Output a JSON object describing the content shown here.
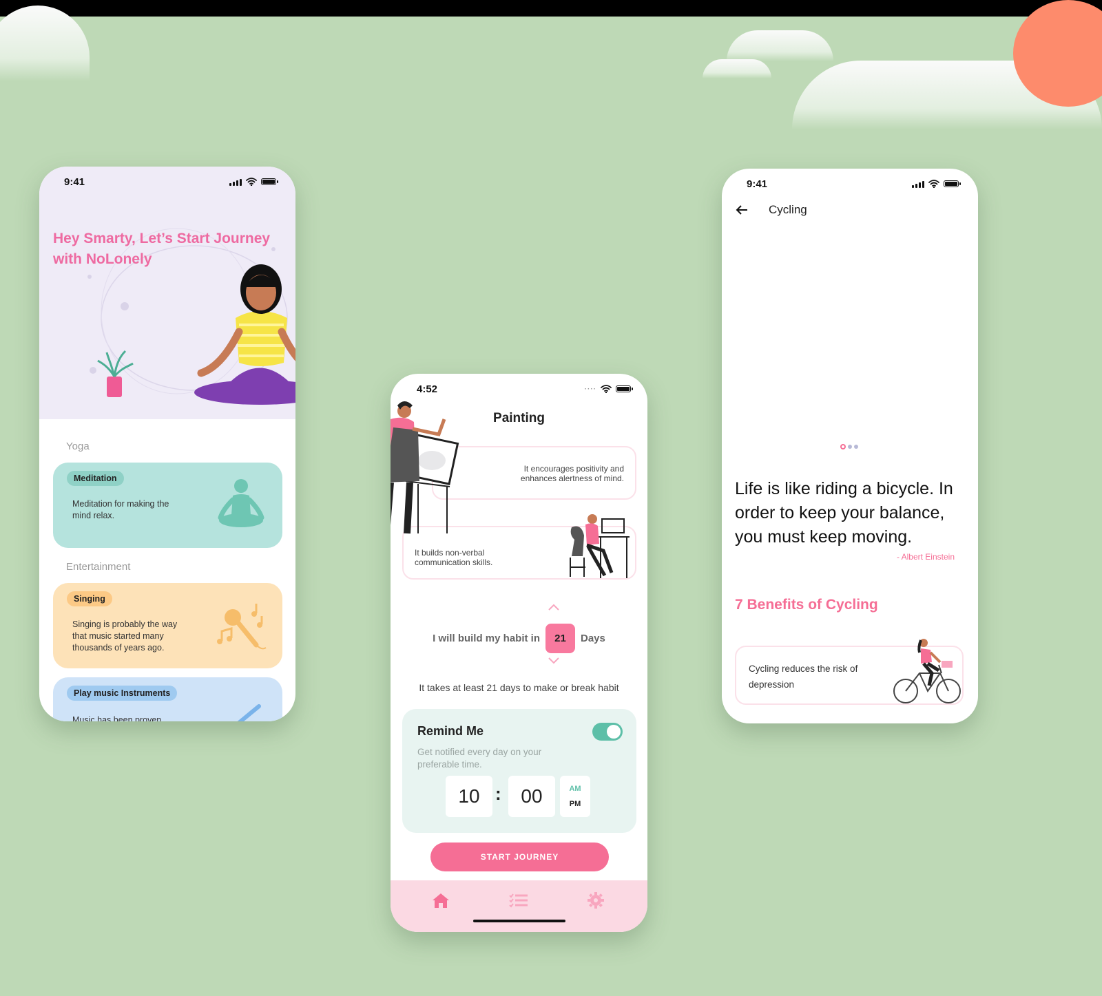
{
  "phone1": {
    "time": "9:41",
    "headline": "Hey Smarty, Let’s Start Journey with NoLonely",
    "sections": [
      "Yoga",
      "Entertainment"
    ],
    "cards": [
      {
        "tag": "Meditation",
        "desc": "Meditation for making the mind relax.",
        "bg": "#b5e3dd",
        "tag_bg": "#8fd1c6",
        "icon": "meditation-icon"
      },
      {
        "tag": "Singing",
        "desc": "Singing is probably the way that music started many thousands of years ago.",
        "bg": "#fde2b8",
        "tag_bg": "#fcc985",
        "icon": "microphone-music-icon"
      },
      {
        "tag": "Play music Instruments",
        "desc": "Music has been proven",
        "bg": "#cfe3f8",
        "tag_bg": "#9fcaf0",
        "icon": "guitar-icon"
      }
    ]
  },
  "phone2": {
    "time": "4:52",
    "title": "Painting",
    "benefits": [
      "It encourages positivity and enhances alertness of mind.",
      "It builds non-verbal communication skills."
    ],
    "habit_prefix": "I will build my habit in",
    "habit_days": "21",
    "habit_suffix": "Days",
    "habit_note": "It takes at least 21 days to make or break habit",
    "remind_title": "Remind Me",
    "remind_sub": "Get notified every day on your preferable time.",
    "remind_enabled": true,
    "hour": "10",
    "minute": "00",
    "am": "AM",
    "pm": "PM",
    "start_label": "START JOURNEY",
    "nav": [
      "home-icon",
      "list-icon",
      "settings-icon"
    ]
  },
  "phone3": {
    "time": "9:41",
    "title": "Cycling",
    "quote": "Life is like riding a bicycle. In order to keep your balance, you must keep moving.",
    "author": "- Albert Einstein",
    "benefits_title": "7 Benefits of Cycling",
    "benefit_text": "Cycling reduces the risk of depression"
  },
  "colors": {
    "background": "#bed9b6",
    "accent_pink": "#f56e95",
    "teal": "#5dbfa8",
    "sun": "#fd8b6c"
  }
}
